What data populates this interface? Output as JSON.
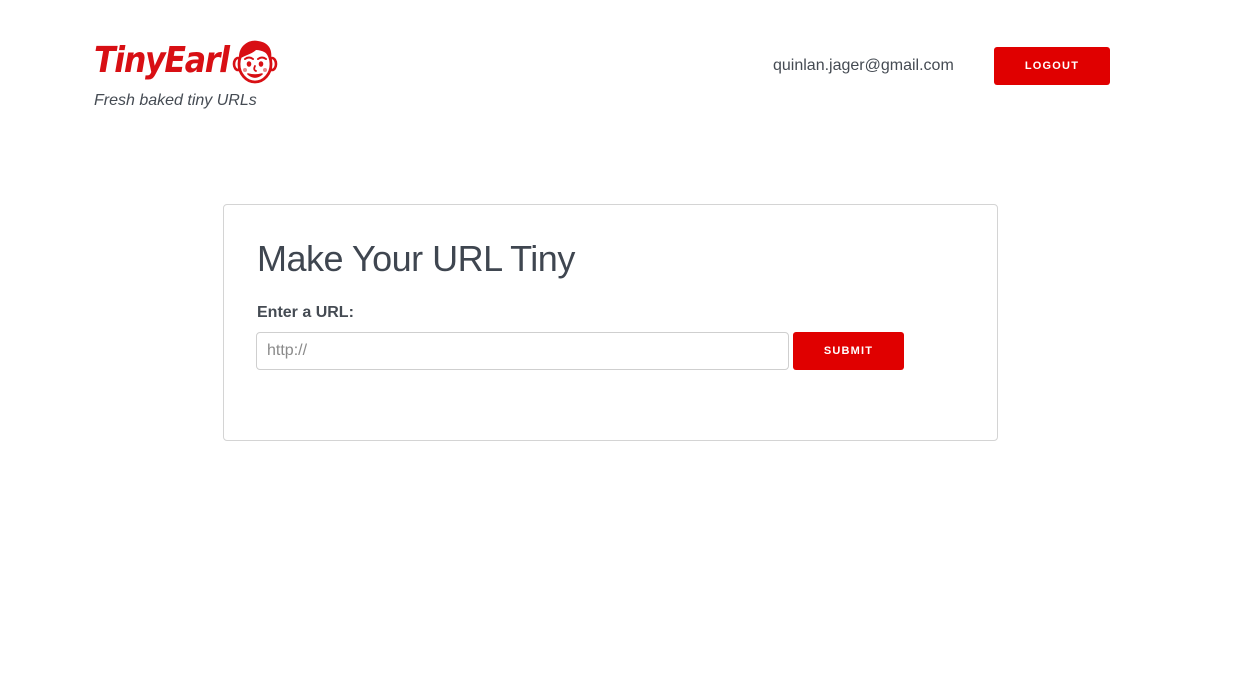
{
  "header": {
    "brand_name": "TinyEarl",
    "tagline": "Fresh baked tiny URLs",
    "user_email": "quinlan.jager@gmail.com",
    "logout_label": "LOGOUT",
    "logo_icon": "earl-face-icon"
  },
  "card": {
    "title": "Make Your URL Tiny",
    "url_label": "Enter a URL:",
    "url_placeholder": "http://",
    "url_value": "",
    "submit_label": "SUBMIT"
  },
  "colors": {
    "accent": "#e00000",
    "brand": "#d80f14",
    "text": "#454b53",
    "card_border": "#d4d4d4"
  }
}
